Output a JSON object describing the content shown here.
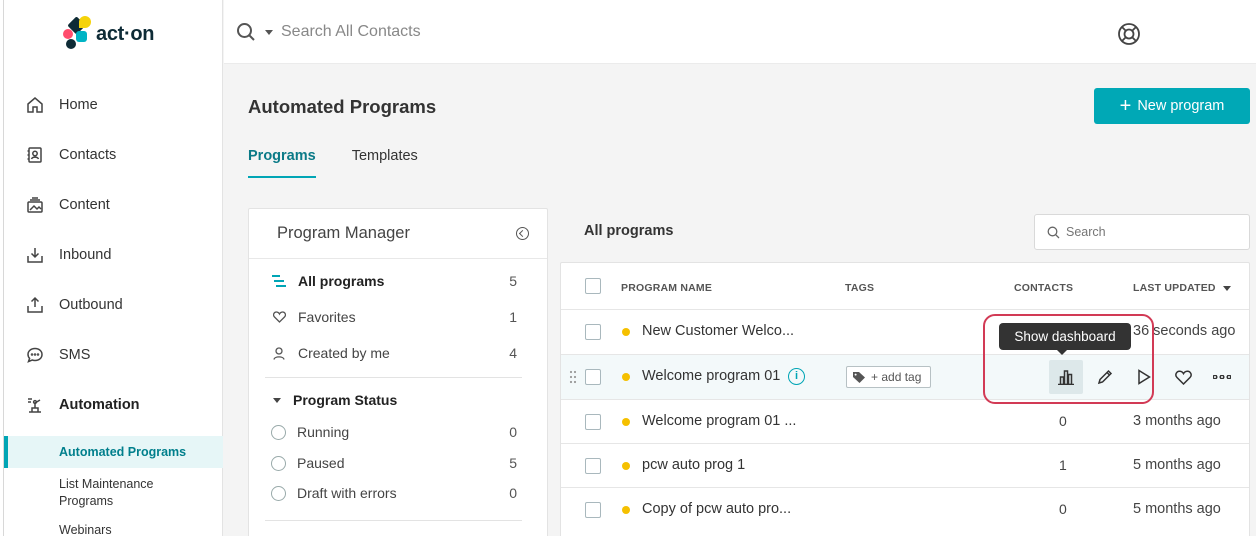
{
  "app": {
    "brand_text": "act·on"
  },
  "sidebar": {
    "items": [
      {
        "label": "Home",
        "icon": "home-icon"
      },
      {
        "label": "Contacts",
        "icon": "contacts-icon"
      },
      {
        "label": "Content",
        "icon": "content-icon"
      },
      {
        "label": "Inbound",
        "icon": "inbound-icon"
      },
      {
        "label": "Outbound",
        "icon": "outbound-icon"
      },
      {
        "label": "SMS",
        "icon": "sms-icon"
      },
      {
        "label": "Automation",
        "icon": "automation-icon"
      }
    ],
    "sub_items": [
      "Automated Programs",
      "List Maintenance Programs",
      "Webinars"
    ]
  },
  "topbar": {
    "search_placeholder": "Search All Contacts"
  },
  "page": {
    "title": "Automated Programs",
    "new_button": "New program",
    "tabs": [
      "Programs",
      "Templates"
    ]
  },
  "manager": {
    "title": "Program Manager",
    "filters": [
      {
        "label": "All programs",
        "count": "5"
      },
      {
        "label": "Favorites",
        "count": "1"
      },
      {
        "label": "Created by me",
        "count": "4"
      }
    ],
    "status_title": "Program Status",
    "statuses": [
      {
        "label": "Running",
        "count": "0"
      },
      {
        "label": "Paused",
        "count": "5"
      },
      {
        "label": "Draft with errors",
        "count": "0"
      }
    ]
  },
  "list": {
    "title": "All programs",
    "search_placeholder": "Search",
    "columns": [
      "PROGRAM NAME",
      "TAGS",
      "CONTACTS",
      "LAST UPDATED"
    ],
    "rows": [
      {
        "name": "New Customer Welco...",
        "contacts": "",
        "updated": "36 seconds ago"
      },
      {
        "name": "Welcome program 01",
        "contacts": "",
        "updated": "",
        "tag_button": "+ add tag"
      },
      {
        "name": "Welcome program 01 ...",
        "contacts": "0",
        "updated": "3 months ago"
      },
      {
        "name": "pcw auto prog 1",
        "contacts": "1",
        "updated": "5 months ago"
      },
      {
        "name": "Copy of pcw auto pro...",
        "contacts": "0",
        "updated": "5 months ago"
      }
    ]
  },
  "tooltip": "Show dashboard",
  "colors": {
    "accent": "#00a8b6",
    "status_dot": "#f5c000",
    "highlight": "#d23a55"
  }
}
